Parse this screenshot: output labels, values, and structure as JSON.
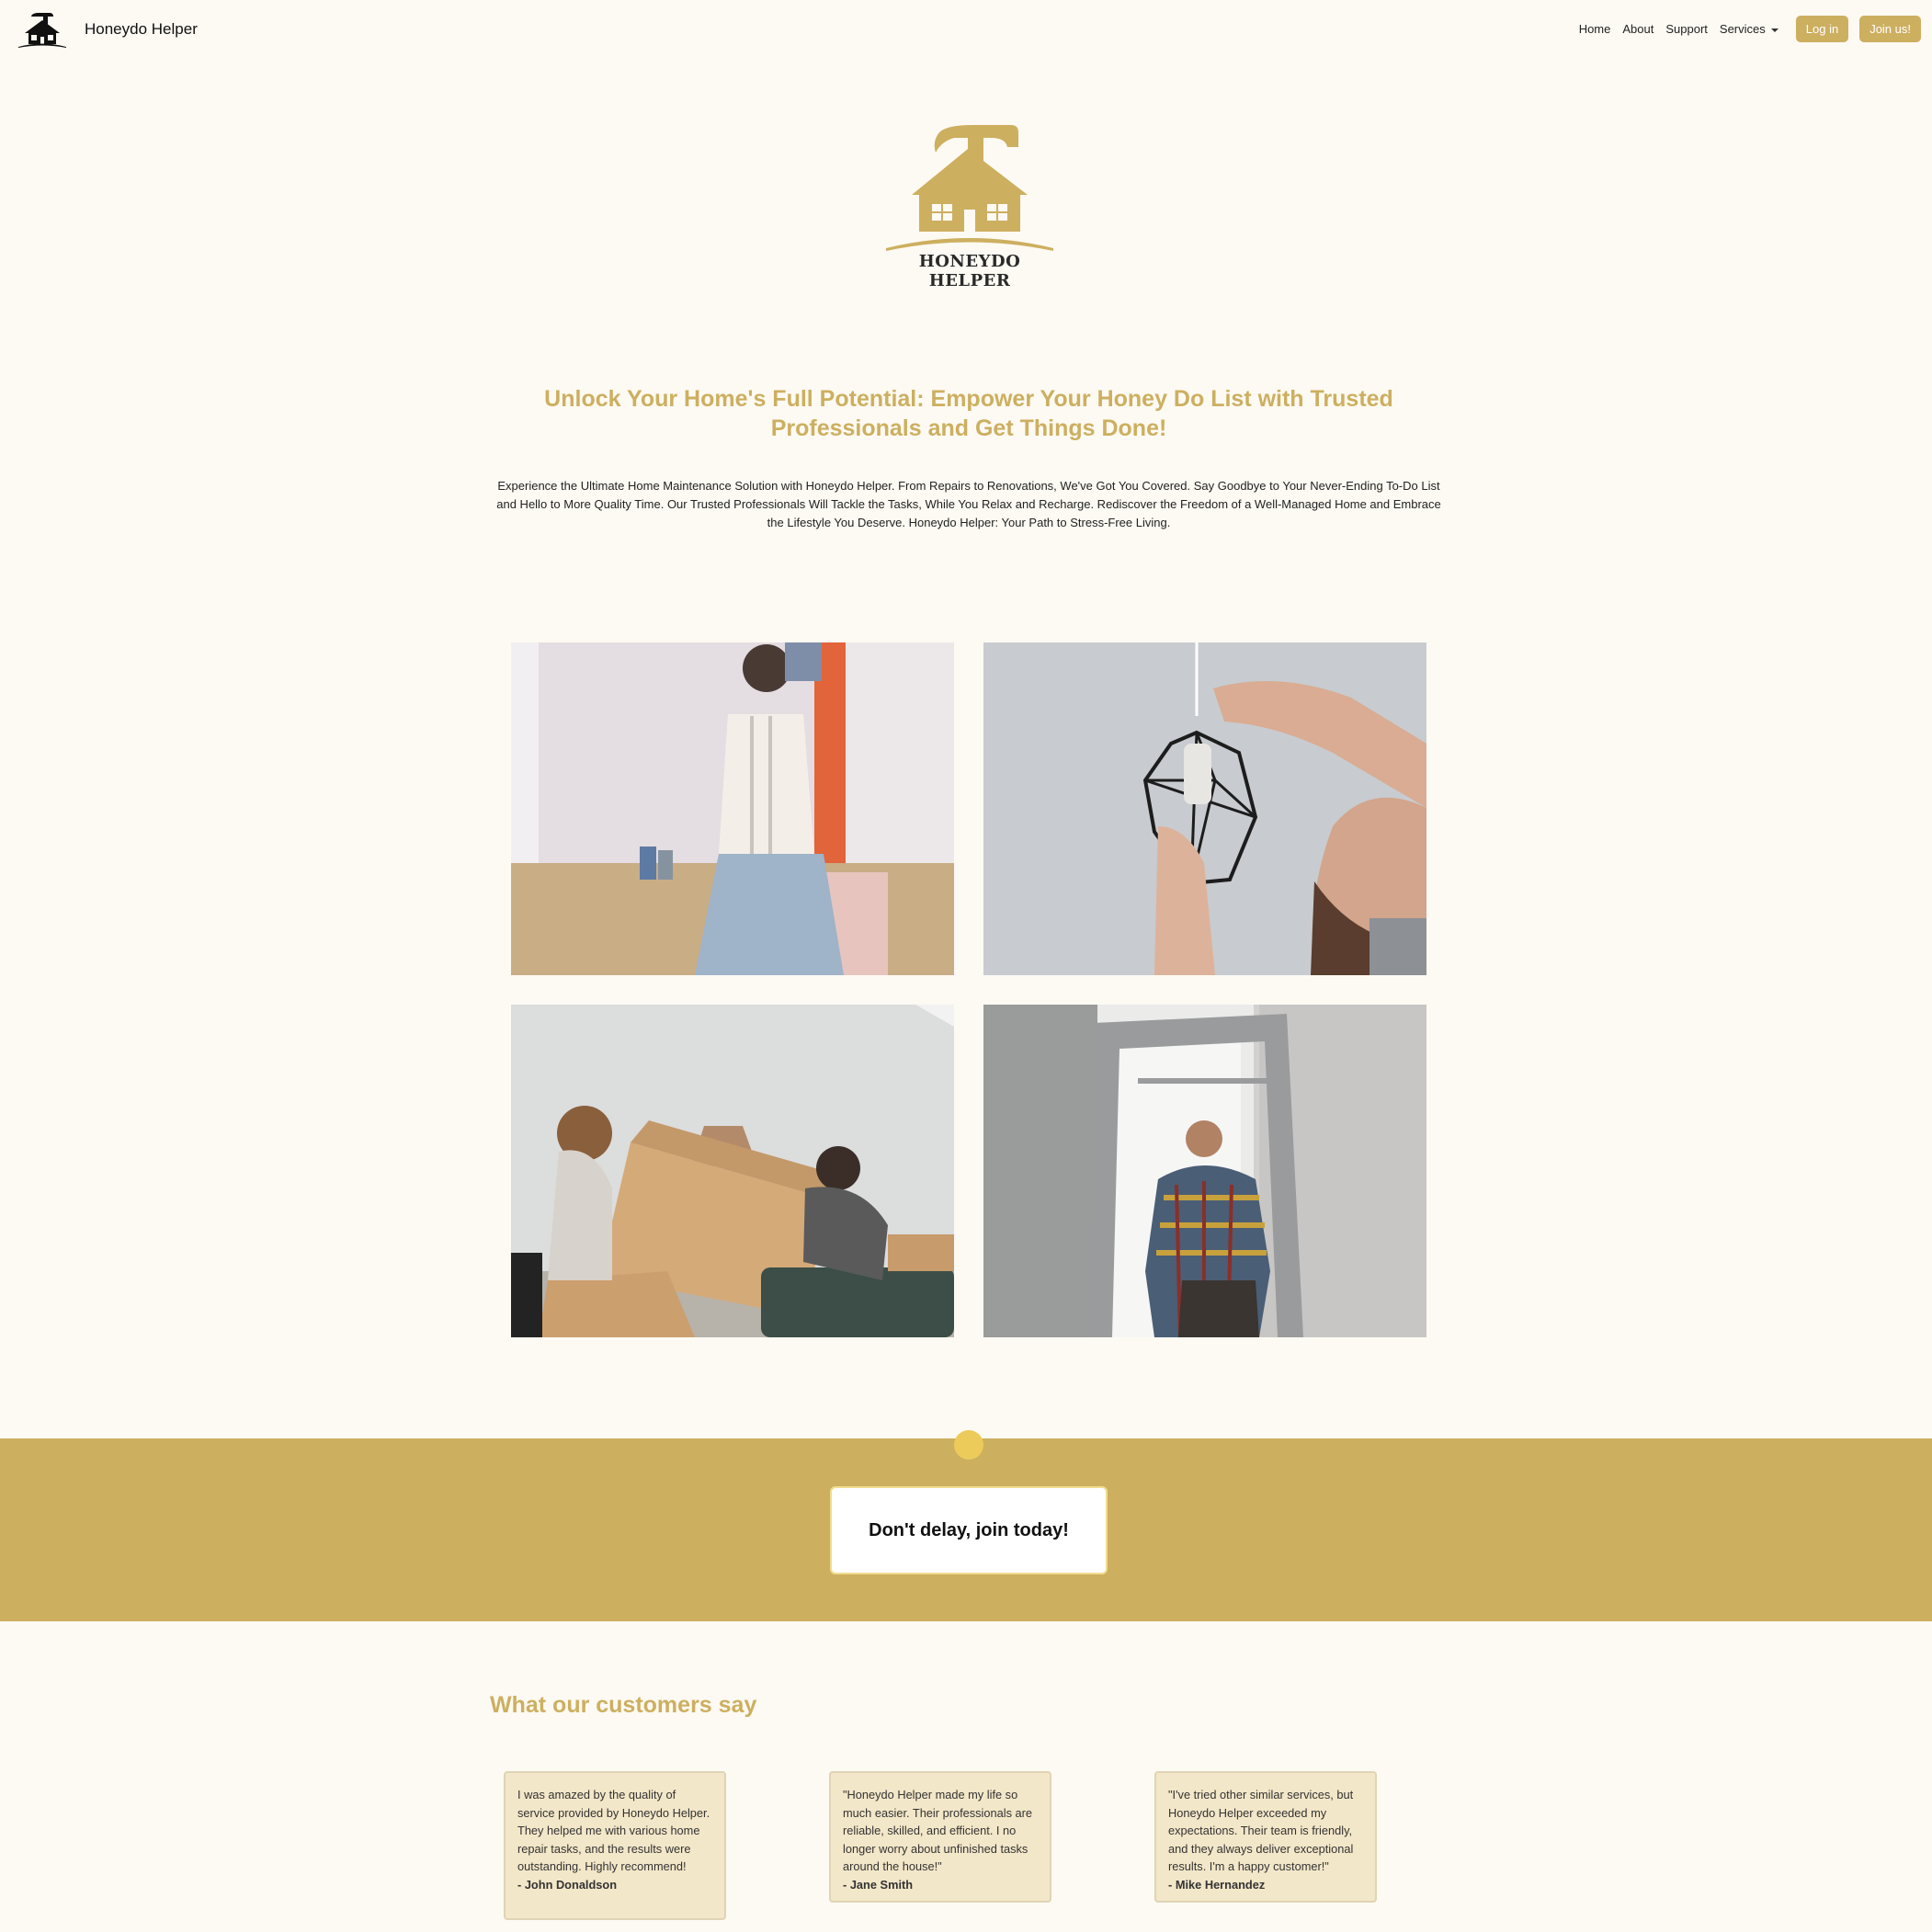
{
  "brand": {
    "name": "Honeydo Helper",
    "logo_text": "HONEYDO HELPER"
  },
  "nav": {
    "links": [
      "Home",
      "About",
      "Support",
      "Services"
    ],
    "login_label": "Log in",
    "join_label": "Join us!"
  },
  "hero": {
    "headline": "Unlock Your Home's Full Potential: Empower Your Honey Do List with Trusted Professionals and Get Things Done!",
    "intro": "Experience the Ultimate Home Maintenance Solution with Honeydo Helper. From Repairs to Renovations, We've Got You Covered. Say Goodbye to Your Never-Ending To-Do List and Hello to More Quality Time. Our Trusted Professionals Will Tackle the Tasks, While You Relax and Recharge. Rediscover the Freedom of a Well-Managed Home and Embrace the Lifestyle You Deserve. Honeydo Helper: Your Path to Stress-Free Living."
  },
  "cta": {
    "label": "Don't delay, join today!"
  },
  "testimonials": {
    "title": "What our customers say",
    "items": [
      {
        "quote": "I was amazed by the quality of service provided by Honeydo Helper. They helped me with various home repair tasks, and the results were outstanding. Highly recommend!",
        "author": "- John Donaldson"
      },
      {
        "quote": "\"Honeydo Helper made my life so much easier. Their professionals are reliable, skilled, and efficient. I no longer worry about unfinished tasks around the house!\"",
        "author": "- Jane Smith"
      },
      {
        "quote": "\"I've tried other similar services, but Honeydo Helper exceeded my expectations. Their team is friendly, and they always deliver exceptional results. I'm a happy customer!\"",
        "author": "- Mike Hernandez"
      }
    ]
  },
  "colors": {
    "accent": "#cdaf60",
    "background": "#fdfaf3",
    "card": "#f3e7c9",
    "dot": "#eccb5a"
  }
}
